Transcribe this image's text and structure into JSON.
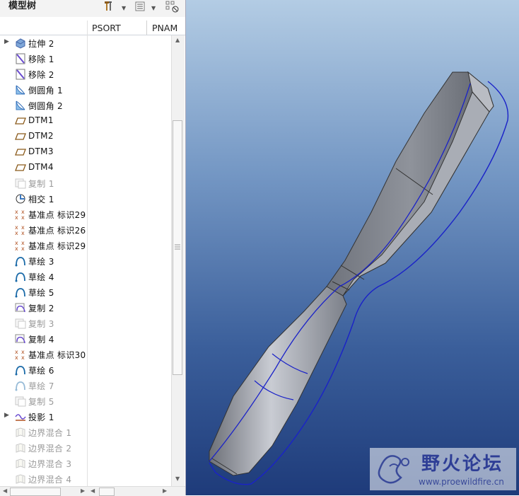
{
  "panel": {
    "title": "模型树",
    "columns": [
      "PSORT",
      "PNAM"
    ]
  },
  "tree": [
    {
      "label": "拉伸 2",
      "icon": "extrude-icon",
      "expandable": true,
      "dim": false
    },
    {
      "label": "移除 1",
      "icon": "remove-icon",
      "expandable": false,
      "dim": false
    },
    {
      "label": "移除 2",
      "icon": "remove-icon",
      "expandable": false,
      "dim": false
    },
    {
      "label": "倒圆角 1",
      "icon": "round-icon",
      "expandable": false,
      "dim": false
    },
    {
      "label": "倒圆角 2",
      "icon": "round-icon",
      "expandable": false,
      "dim": false
    },
    {
      "label": "DTM1",
      "icon": "datum-plane-icon",
      "expandable": false,
      "dim": false
    },
    {
      "label": "DTM2",
      "icon": "datum-plane-icon",
      "expandable": false,
      "dim": false
    },
    {
      "label": "DTM3",
      "icon": "datum-plane-icon",
      "expandable": false,
      "dim": false
    },
    {
      "label": "DTM4",
      "icon": "datum-plane-icon",
      "expandable": false,
      "dim": false
    },
    {
      "label": "复制 1",
      "icon": "copy-icon",
      "expandable": false,
      "dim": true
    },
    {
      "label": "相交 1",
      "icon": "intersect-icon",
      "expandable": false,
      "dim": false
    },
    {
      "label": "基准点 标识29",
      "icon": "datum-point-icon",
      "expandable": false,
      "dim": false
    },
    {
      "label": "基准点 标识26",
      "icon": "datum-point-icon",
      "expandable": false,
      "dim": false
    },
    {
      "label": "基准点 标识29",
      "icon": "datum-point-icon",
      "expandable": false,
      "dim": false
    },
    {
      "label": "草绘 3",
      "icon": "sketch-icon",
      "expandable": false,
      "dim": false
    },
    {
      "label": "草绘 4",
      "icon": "sketch-icon",
      "expandable": false,
      "dim": false
    },
    {
      "label": "草绘 5",
      "icon": "sketch-icon",
      "expandable": false,
      "dim": false
    },
    {
      "label": "复制 2",
      "icon": "copy-curve-icon",
      "expandable": false,
      "dim": false
    },
    {
      "label": "复制 3",
      "icon": "copy-icon",
      "expandable": false,
      "dim": true
    },
    {
      "label": "复制 4",
      "icon": "copy-curve-icon",
      "expandable": false,
      "dim": false
    },
    {
      "label": "基准点 标识30",
      "icon": "datum-point-icon",
      "expandable": false,
      "dim": false
    },
    {
      "label": "草绘 6",
      "icon": "sketch-icon",
      "expandable": false,
      "dim": false
    },
    {
      "label": "草绘 7",
      "icon": "sketch-icon",
      "expandable": false,
      "dim": true
    },
    {
      "label": "复制 5",
      "icon": "copy-icon",
      "expandable": false,
      "dim": true
    },
    {
      "label": "投影 1",
      "icon": "projection-icon",
      "expandable": true,
      "dim": false
    },
    {
      "label": "边界混合 1",
      "icon": "boundary-blend-icon",
      "expandable": false,
      "dim": true
    },
    {
      "label": "边界混合 2",
      "icon": "boundary-blend-icon",
      "expandable": false,
      "dim": true
    },
    {
      "label": "边界混合 3",
      "icon": "boundary-blend-icon",
      "expandable": false,
      "dim": true
    },
    {
      "label": "边界混合 4",
      "icon": "boundary-blend-icon",
      "expandable": false,
      "dim": true
    }
  ],
  "watermark": {
    "title": "野火论坛",
    "url": "www.proewildfire.cn"
  },
  "colors": {
    "viewport_top": "#b3cce4",
    "viewport_bottom": "#1e3b7a",
    "model_gray": "#8a8d95",
    "curve_blue": "#1a22c8"
  }
}
